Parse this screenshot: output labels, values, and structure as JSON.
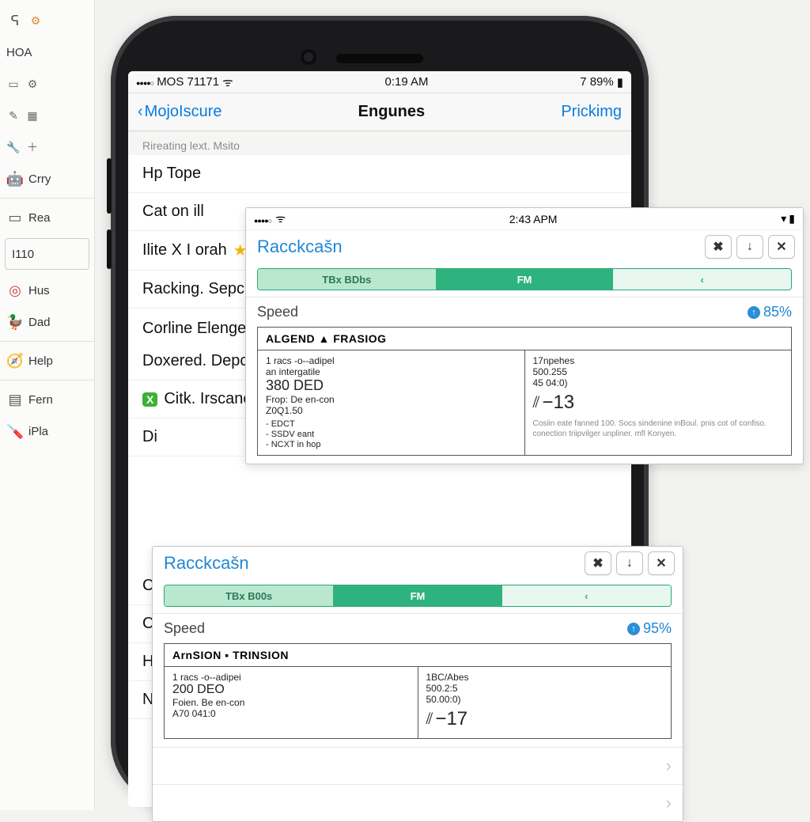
{
  "sidebar": {
    "items": [
      {
        "label": "HOA"
      },
      {
        "label": ""
      },
      {
        "label": ""
      },
      {
        "label": "Crry"
      },
      {
        "label": "Rea"
      },
      {
        "label": "I110"
      },
      {
        "label": "Hus"
      },
      {
        "label": "Dad"
      },
      {
        "label": "Help"
      },
      {
        "label": "Fern"
      },
      {
        "label": "iPla"
      }
    ]
  },
  "phone": {
    "status": {
      "carrier": "MOS 71171",
      "time": "0:19 AM",
      "battery": "7 89%"
    },
    "nav": {
      "back": "MojoIscure",
      "title": "Engunes",
      "right": "Prickimg"
    },
    "section1_header": "Rireating lext. Msito",
    "items1": [
      {
        "label": "Hp Tope"
      },
      {
        "label": "Cat on ill"
      },
      {
        "label": "Ilite X I orah",
        "star": true
      },
      {
        "label": "Racking. Sepcl"
      }
    ],
    "section2_header": "Corline Elengel",
    "items2": [
      {
        "label": "Doxered. Depc"
      },
      {
        "label": "Citk. Irscancl",
        "badge": "X"
      },
      {
        "label": "Di"
      }
    ],
    "items3": [
      {
        "label": "C"
      },
      {
        "label": "C"
      },
      {
        "label": "Hiofinmy. Lumain Puran"
      },
      {
        "label": "Nume Case"
      }
    ]
  },
  "popup1": {
    "status_time": "2:43 APM",
    "title": "Racckcašn",
    "seg": {
      "a": "TBx BDbs",
      "b": "FM",
      "c": "‹"
    },
    "speed_label": "Speed",
    "speed_pct": "85%",
    "table_header": "ALGEND ▲ FRASIOG",
    "left_col": {
      "l1": "1 racs -o--adipel",
      "l2": "an intergatile",
      "big": "380 DED",
      "l3": "Frop: De en-con",
      "l4": "Z0Q1.50",
      "bullets": [
        "- EDCT",
        "- SSDV eant",
        "- NCXT in hop"
      ]
    },
    "right_col": {
      "l1": "17npehes",
      "l2": "500.255",
      "l3": "45 04:0)",
      "bignum": "−13",
      "note": "Cosiin eate fanned 100. Socs sindenine inBoul. pnis cot of confiso. conection triipvilger unpliner. mfl Konyen."
    }
  },
  "popup2": {
    "title": "Racckcašn",
    "seg": {
      "a": "TBx B00s",
      "b": "FM",
      "c": "‹"
    },
    "speed_label": "Speed",
    "speed_pct": "95%",
    "table_header": "ArnSION ▪ TRINSION",
    "left_col": {
      "l1": "1 racs -o--adipei",
      "big1": "200 DEO",
      "l2": "Foien. Be en-con",
      "l3": "A70 041:0"
    },
    "right_col": {
      "l1": "1BC/Abes",
      "l2": "500.2:5",
      "l3": "50.00:0)",
      "bignum": "−17"
    }
  }
}
